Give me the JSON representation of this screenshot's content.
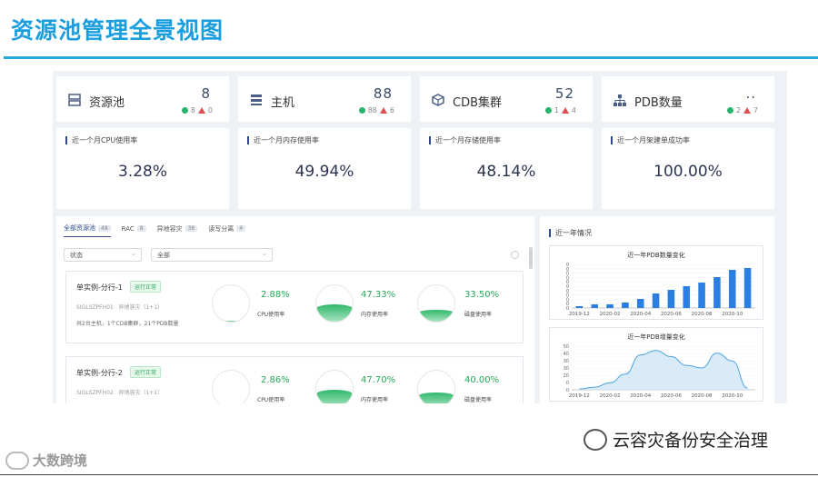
{
  "page_title": "资源池管理全景视图",
  "kpis": [
    {
      "label": "资源池",
      "value": "8",
      "ok": "8",
      "warn": "0",
      "icon": "server-icon"
    },
    {
      "label": "主机",
      "value": "88",
      "ok": "88",
      "warn": "6",
      "icon": "host-list-icon"
    },
    {
      "label": "CDB集群",
      "value": "52",
      "ok": "1",
      "warn": "4",
      "icon": "cube-icon"
    },
    {
      "label": "PDB数量",
      "value": "..",
      "ok": "2",
      "warn": "7",
      "icon": "tree-icon"
    }
  ],
  "rates": [
    {
      "label": "近一个月CPU使用率",
      "value": "3.28%"
    },
    {
      "label": "近一个月内存使用率",
      "value": "49.94%"
    },
    {
      "label": "近一个月存储使用率",
      "value": "48.14%"
    },
    {
      "label": "近一个月架建单成功率",
      "value": "100.00%"
    }
  ],
  "tabs": [
    {
      "label": "全部资源池",
      "count": "48"
    },
    {
      "label": "RAC",
      "count": "8"
    },
    {
      "label": "异地容灾",
      "count": "38"
    },
    {
      "label": "读写分离",
      "count": "4"
    }
  ],
  "filters": {
    "status_placeholder": "状态",
    "scope_value": "全部"
  },
  "instances": [
    {
      "name": "单实例-分行-1",
      "status": "运行正常",
      "host": "SIGLSZPFH01",
      "host_note": "异地容灾（1+1）",
      "summary": "共2台主机，1个CDB集群，21个PDB数量",
      "metrics": [
        {
          "value": "2.88%",
          "label": "CPU使用率",
          "level": 0.0288
        },
        {
          "value": "47.33%",
          "label": "内存使用率",
          "level": 0.4733
        },
        {
          "value": "33.50%",
          "label": "磁盘使用率",
          "level": 0.335
        }
      ]
    },
    {
      "name": "单实例-分行-2",
      "status": "运行正常",
      "host": "SIGLSZPFH02",
      "host_note": "异地容灾（1+1）",
      "summary": "",
      "metrics": [
        {
          "value": "2.86%",
          "label": "CPU使用率",
          "level": 0.0286
        },
        {
          "value": "47.70%",
          "label": "内存使用率",
          "level": 0.477
        },
        {
          "value": "40.00%",
          "label": "磁盘使用率",
          "level": 0.4
        }
      ]
    }
  ],
  "side": {
    "title": "近一年情况"
  },
  "chart_data": [
    {
      "type": "bar",
      "title": "近一年PDB数量变化",
      "x_ticks": [
        "2019-12",
        "2020-02",
        "2020-04",
        "2020-06",
        "2020-08",
        "2020-10"
      ],
      "categories": [
        "2019-12",
        "2020-01",
        "2020-02",
        "2020-03",
        "2020-04",
        "2020-05",
        "2020-06",
        "2020-07",
        "2020-08",
        "2020-09",
        "2020-10",
        "2020-11"
      ],
      "values": [
        1,
        2,
        2,
        3,
        5,
        8,
        10,
        12,
        14,
        17,
        21,
        22
      ],
      "ylim": [
        0,
        24
      ],
      "y_ticks": [
        0,
        0,
        0,
        0,
        0,
        0,
        0,
        0,
        0,
        0,
        0
      ],
      "color": "#2b7fe0"
    },
    {
      "type": "area",
      "title": "近一年PDB增量变化",
      "x_ticks": [
        "2019-12",
        "2020-02",
        "2020-04",
        "2020-06",
        "2020-08",
        "2020-10"
      ],
      "categories": [
        "2019-12",
        "2020-01",
        "2020-02",
        "2020-03",
        "2020-04",
        "2020-05",
        "2020-06",
        "2020-07",
        "2020-08",
        "2020-09",
        "2020-10",
        "2020-11"
      ],
      "values": [
        1,
        3,
        8,
        18,
        40,
        45,
        38,
        28,
        25,
        42,
        33,
        2
      ],
      "ylim": [
        0,
        50
      ],
      "y_ticks": [
        "0",
        "0",
        "20",
        "30",
        "30",
        "40",
        "50"
      ],
      "color": "#4aa3df"
    }
  ],
  "watermark_left": "大数跨境",
  "watermark_right": "云容灾备份安全治理"
}
